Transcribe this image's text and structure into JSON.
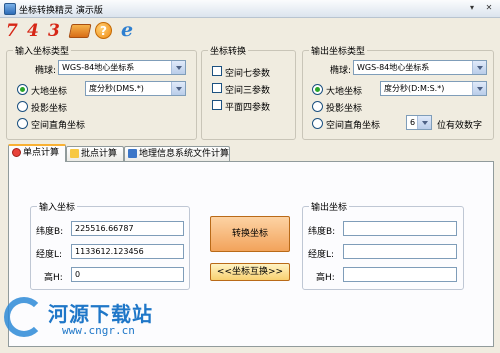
{
  "window": {
    "title": "坐标转换精灵 演示版",
    "controls": [
      "▾",
      "✕"
    ]
  },
  "toolbar": {
    "btn1": "7",
    "btn2": "4",
    "btn3": "3",
    "help": "?",
    "ie": "e"
  },
  "input_type": {
    "legend": "输入坐标类型",
    "ellipsoid_label": "椭球:",
    "ellipsoid_value": "WGS-84地心坐标系",
    "radios": [
      "大地坐标",
      "投影坐标",
      "空间直角坐标"
    ],
    "selected_radio": 0,
    "format_value": "度分秒(DMS.*)"
  },
  "conversion": {
    "legend": "坐标转换",
    "options": [
      "空间七参数",
      "空间三参数",
      "平面四参数"
    ]
  },
  "output_type": {
    "legend": "输出坐标类型",
    "ellipsoid_label": "椭球:",
    "ellipsoid_value": "WGS-84地心坐标系",
    "radios": [
      "大地坐标",
      "投影坐标",
      "空间直角坐标"
    ],
    "selected_radio": 0,
    "format_value": "度分秒(D:M:S.*)",
    "digits_value": "6",
    "digits_suffix": "位有效数字"
  },
  "tabs": [
    "单点计算",
    "批点计算",
    "地理信息系统文件计算"
  ],
  "active_tab": 0,
  "input_coords": {
    "legend": "输入坐标",
    "fields": [
      {
        "label": "纬度B:",
        "value": "225516.66787"
      },
      {
        "label": "经度L:",
        "value": "1133612.123456"
      },
      {
        "label": "高H:",
        "value": "0"
      }
    ]
  },
  "output_coords": {
    "legend": "输出坐标",
    "fields": [
      {
        "label": "纬度B:",
        "value": ""
      },
      {
        "label": "经度L:",
        "value": ""
      },
      {
        "label": "高H:",
        "value": ""
      }
    ]
  },
  "buttons": {
    "convert": "转换坐标",
    "swap": "<<坐标互换>>"
  },
  "watermark": {
    "name": "河源下载站",
    "url": "www.cngr.cn"
  },
  "colors": {
    "accent": "#f9b134",
    "button": "#f2a35b",
    "watermark": "#1f77c8"
  }
}
